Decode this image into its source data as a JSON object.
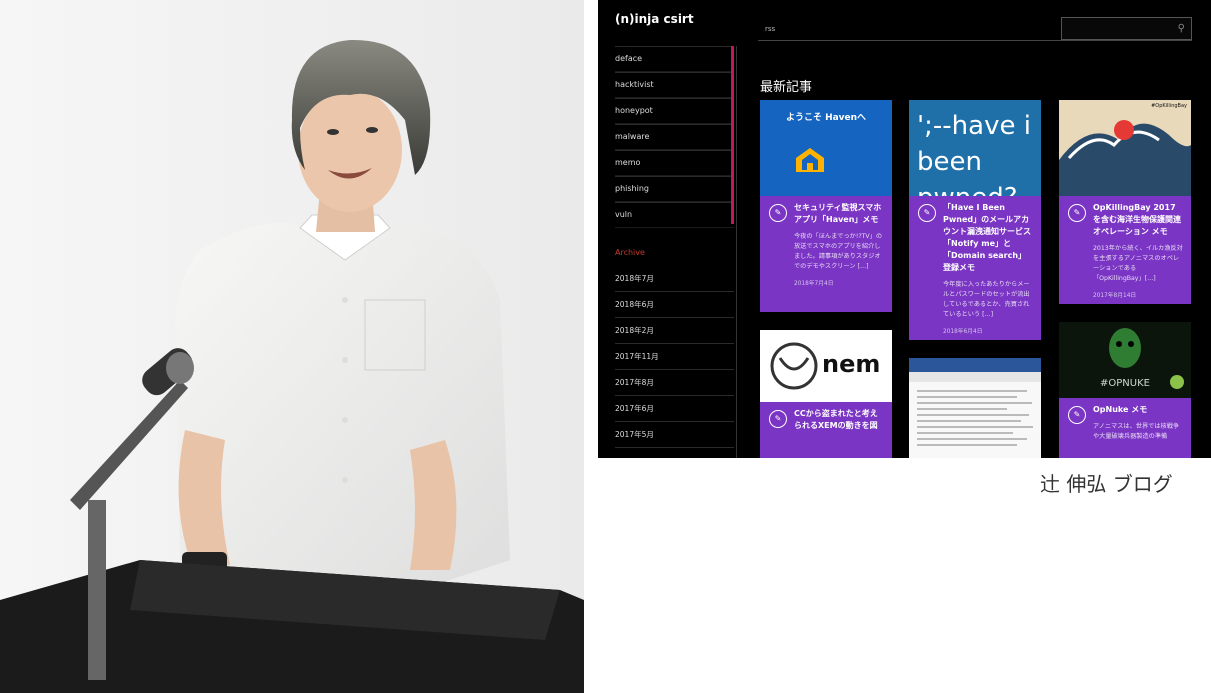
{
  "blog": {
    "site_title": "(n)inja csirt",
    "nav": [
      "deface",
      "hacktivist",
      "honeypot",
      "malware",
      "memo",
      "phishing",
      "vuln"
    ],
    "archive_heading": "Archive",
    "archive": [
      "2018年7月",
      "2018年6月",
      "2018年2月",
      "2017年11月",
      "2017年8月",
      "2017年6月",
      "2017年5月"
    ],
    "rss": "rss",
    "latest_heading": "最新記事",
    "cards": [
      {
        "image_text": "ようこそ Havenへ",
        "title": "セキュリティ監視スマホアプリ「Haven」メモ",
        "excerpt": "今夜の「ほんまでっか!?TV」の放送でスマホのアプリを紹介しました。請事項がありスタジオでのデモやスクリーン […]",
        "date": "2018年7月4日"
      },
      {
        "image_text": "';--have i been pwned?",
        "title": "「Have I Been Pwned」のメールアカウント漏洩通知サービス「Notify me」と「Domain search」登録メモ",
        "excerpt": "今年度に入ったあたりからメールとパスワードのセットが流出しているであるとか、売買されているという […]",
        "date": "2018年6月4日"
      },
      {
        "image_text": "#OpKillingBay",
        "title": "OpKillingBay 2017 を含む海洋生物保護関連オペレーション メモ",
        "excerpt": "2013年から続く、イルカ漁反対を主張するアノニマスのオペレーションである「OpKillingBay」[…]",
        "date": "2017年8月14日"
      },
      {
        "image_text": "nem",
        "title": "CCから盗まれたと考えられるXEMの動きを図",
        "excerpt": "",
        "date": ""
      },
      {
        "image_text": "",
        "title": "",
        "excerpt": "",
        "date": ""
      },
      {
        "image_text": "#OPNUKE",
        "title": "OpNuke メモ",
        "excerpt": "アノニマスは、世界では核戦争や大量破壊兵器製造の準備",
        "date": ""
      }
    ]
  },
  "caption": "辻 伸弘 ブログ",
  "colors": {
    "card_purple": "#7b35c4",
    "nav_accent": "#c2185b",
    "archive_heading": "#c0392b"
  }
}
